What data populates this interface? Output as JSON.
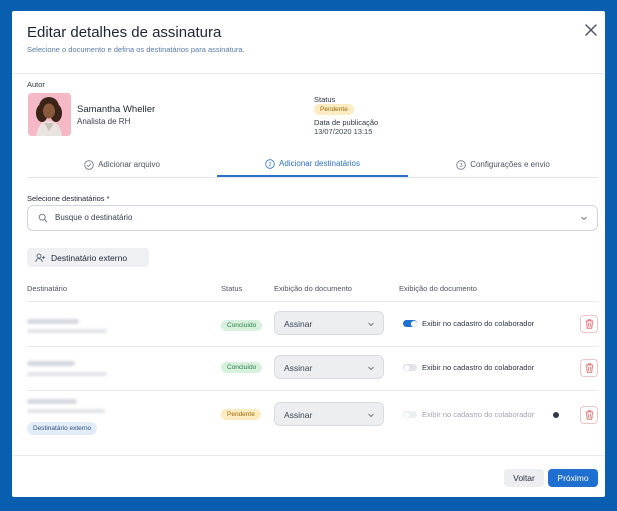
{
  "modal": {
    "title": "Editar detalhes de assinatura",
    "subtitle": "Selecione o documento e defina os destinatários para assinatura."
  },
  "author": {
    "section_label": "Autor",
    "name": "Samantha Wheller",
    "role": "Analista de RH"
  },
  "document_status": {
    "status_label": "Status",
    "status_value": "Pendente",
    "pubdate_label": "Data de publicação",
    "pubdate_value": "13/07/2020 13:15"
  },
  "steps": [
    {
      "number": "1",
      "label": "Adicionar arquivo",
      "state": "done"
    },
    {
      "number": "2",
      "label": "Adicionar destinatários",
      "state": "active"
    },
    {
      "number": "3",
      "label": "Configurações e envio",
      "state": "todo"
    }
  ],
  "recipients_select": {
    "label": "Selecione destinatários *",
    "placeholder": "Busque o destinatário"
  },
  "external_button": {
    "label": "Destinatário externo"
  },
  "table": {
    "headers": [
      "Destinatário",
      "Status",
      "Exibição do documento",
      "Exibição do documento"
    ],
    "rows": [
      {
        "status": "Concluído",
        "action": "Assinar",
        "toggle_label": "Exibir no cadastro do colaborador",
        "toggle_on": true,
        "external_tag": ""
      },
      {
        "status": "Concluído",
        "action": "Assinar",
        "toggle_label": "Exibir no cadastro do colaborador",
        "toggle_on": false,
        "external_tag": ""
      },
      {
        "status": "Pendente",
        "action": "Assinar",
        "toggle_label": "Exibir no cadastro do colaborador",
        "toggle_on": false,
        "external_tag": "Destinatário externo"
      }
    ]
  },
  "footer": {
    "back_label": "Voltar",
    "next_label": "Próximo"
  },
  "colors": {
    "accent": "#1f6fd0",
    "background": "#0a5eb0",
    "pending": "#fdebc2",
    "done": "#d7f1de",
    "danger": "#e05a5a"
  },
  "icons": [
    "close-icon",
    "check-circle-icon",
    "step-two-icon",
    "step-three-icon",
    "search-icon",
    "chevron-down-icon",
    "add-user-icon",
    "trash-icon",
    "info-icon"
  ]
}
